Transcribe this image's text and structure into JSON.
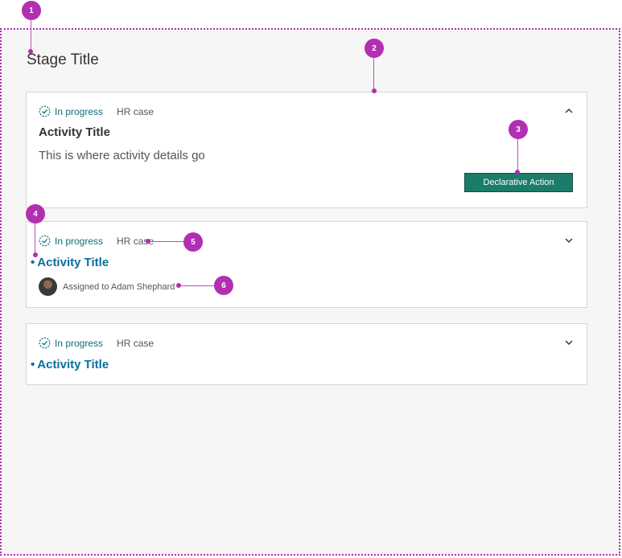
{
  "stage": {
    "title": "Stage Title"
  },
  "cards": [
    {
      "status": "In progress",
      "type": "HR case",
      "title": "Activity Title",
      "details": "This is where activity details go",
      "action_label": "Declarative Action",
      "expanded": true
    },
    {
      "status": "In progress",
      "type": "HR case",
      "title": "Activity Title",
      "assignee": "Assigned to Adam Shephard",
      "expanded": false
    },
    {
      "status": "In progress",
      "type": "HR case",
      "title": "Activity Title",
      "expanded": false
    }
  ],
  "annotations": [
    "1",
    "2",
    "3",
    "4",
    "5",
    "6"
  ],
  "colors": {
    "annotation": "#b12fb0",
    "status": "#0a6f7c",
    "link": "#0a6f9c",
    "action": "#1b7c6a"
  },
  "icons": {
    "status": "check-circle-dashed-icon",
    "expand": "chevron-down-icon",
    "collapse": "chevron-up-icon"
  }
}
